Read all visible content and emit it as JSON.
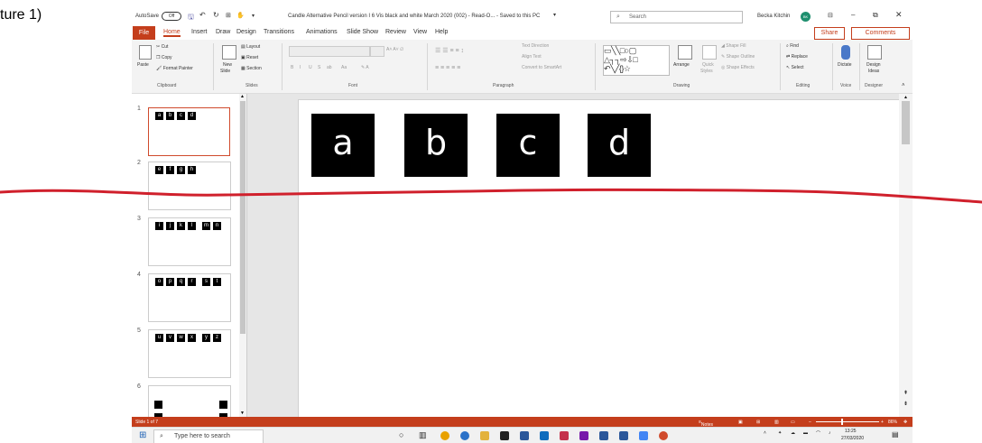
{
  "caption": "ture 1)",
  "titlebar": {
    "autosave_label": "AutoSave",
    "autosave_state": "Off",
    "doc_title": "Candle Alternative Pencil version I 6 Vis black and white March 2020 (002) - Read-O... - Saved to this PC",
    "search_placeholder": "Search",
    "user_name": "Becka Kitchin",
    "user_initials": "BK"
  },
  "tabs": {
    "items": [
      "File",
      "Home",
      "Insert",
      "Draw",
      "Design",
      "Transitions",
      "Animations",
      "Slide Show",
      "Review",
      "View",
      "Help"
    ],
    "share_label": "Share",
    "comments_label": "Comments"
  },
  "ribbon": {
    "clipboard": {
      "paste": "Paste",
      "cut": "Cut",
      "copy": "Copy",
      "format_painter": "Format Painter",
      "group": "Clipboard"
    },
    "slides": {
      "new_slide_1": "New",
      "new_slide_2": "Slide",
      "layout": "Layout",
      "reset": "Reset",
      "section": "Section",
      "group": "Slides"
    },
    "font": {
      "group": "Font",
      "bold": "B",
      "italic": "I",
      "underline": "U",
      "strike": "S",
      "abc": "ab",
      "clear": "Aa"
    },
    "paragraph": {
      "group": "Paragraph",
      "text_direction": "Text Direction",
      "align_text": "Align Text",
      "convert_smartart": "Convert to SmartArt"
    },
    "drawing": {
      "group": "Drawing",
      "arrange": "Arrange",
      "quick_styles_1": "Quick",
      "quick_styles_2": "Styles",
      "shape_fill": "Shape Fill",
      "shape_outline": "Shape Outline",
      "shape_effects": "Shape Effects"
    },
    "editing": {
      "group": "Editing",
      "find": "Find",
      "replace": "Replace",
      "select": "Select"
    },
    "voice": {
      "group": "Voice",
      "dictate": "Dictate"
    },
    "designer": {
      "group": "Designer",
      "ideas_1": "Design",
      "ideas_2": "Ideas"
    }
  },
  "thumbnails": [
    {
      "number": "1",
      "chips": [
        "a",
        "b",
        "c",
        "d"
      ],
      "selected": true
    },
    {
      "number": "2",
      "chips": [
        "e",
        "f",
        "g",
        "h"
      ],
      "selected": false
    },
    {
      "number": "3",
      "chips": [
        "i",
        "j",
        "k",
        "l",
        "m",
        "n"
      ],
      "selected": false
    },
    {
      "number": "4",
      "chips": [
        "o",
        "p",
        "q",
        "r",
        "s",
        "t"
      ],
      "selected": false
    },
    {
      "number": "5",
      "chips": [
        "u",
        "v",
        "w",
        "x",
        "y",
        "z"
      ],
      "selected": false
    },
    {
      "number": "6",
      "chips": [],
      "selected": false
    }
  ],
  "main_slide": {
    "tiles": [
      "a",
      "b",
      "c",
      "d"
    ]
  },
  "statusbar": {
    "slide_info": "Slide 1 of 7",
    "notes": "Notes",
    "zoom": "86%"
  },
  "taskbar": {
    "search_placeholder": "Type here to search",
    "time": "13:25",
    "date": "27/03/2020"
  },
  "annotation": {
    "color": "#d0202c"
  },
  "colors": {
    "accent": "#c43e1c"
  }
}
